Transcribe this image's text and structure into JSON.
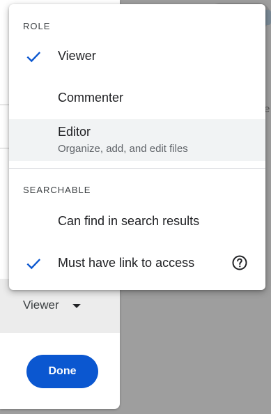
{
  "menu": {
    "sections": [
      {
        "title": "ROLE",
        "items": [
          {
            "label": "Viewer",
            "checked": true
          },
          {
            "label": "Commenter",
            "checked": false
          },
          {
            "label": "Editor",
            "sublabel": "Organize, add, and edit files",
            "checked": false,
            "highlighted": true
          }
        ]
      },
      {
        "title": "SEARCHABLE",
        "items": [
          {
            "label": "Can find in search results",
            "checked": false
          },
          {
            "label": "Must have link to access",
            "checked": true,
            "help_icon": "help-circle-icon"
          }
        ]
      }
    ]
  },
  "dialog": {
    "role_select_value": "Viewer",
    "done_label": "Done",
    "partial_text": "e"
  },
  "colors": {
    "accent": "#0b57d0",
    "check": "#0b57d0",
    "highlight": "#f1f3f4",
    "scrim": "#9e9e9e"
  }
}
